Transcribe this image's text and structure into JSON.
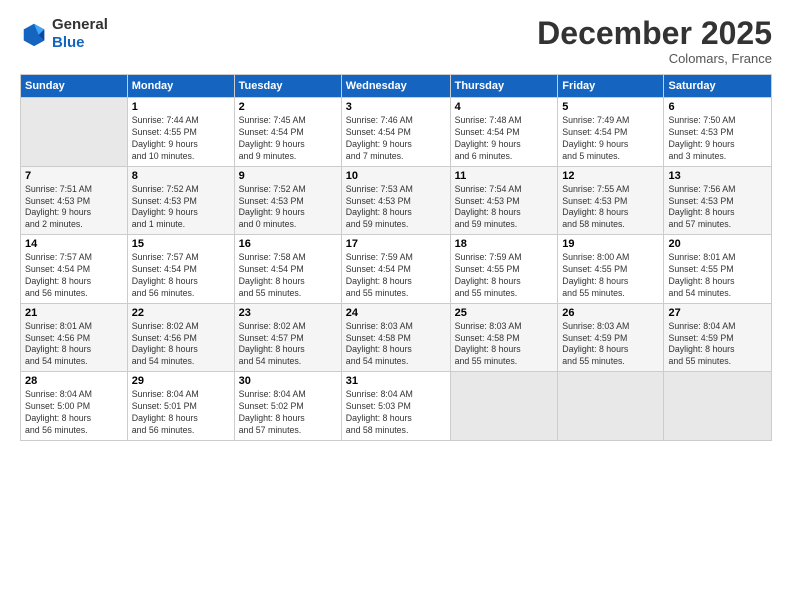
{
  "header": {
    "logo_line1": "General",
    "logo_line2": "Blue",
    "title": "December 2025",
    "location": "Colomars, France"
  },
  "days_of_week": [
    "Sunday",
    "Monday",
    "Tuesday",
    "Wednesday",
    "Thursday",
    "Friday",
    "Saturday"
  ],
  "weeks": [
    [
      {
        "day": "",
        "info": ""
      },
      {
        "day": "1",
        "info": "Sunrise: 7:44 AM\nSunset: 4:55 PM\nDaylight: 9 hours\nand 10 minutes."
      },
      {
        "day": "2",
        "info": "Sunrise: 7:45 AM\nSunset: 4:54 PM\nDaylight: 9 hours\nand 9 minutes."
      },
      {
        "day": "3",
        "info": "Sunrise: 7:46 AM\nSunset: 4:54 PM\nDaylight: 9 hours\nand 7 minutes."
      },
      {
        "day": "4",
        "info": "Sunrise: 7:48 AM\nSunset: 4:54 PM\nDaylight: 9 hours\nand 6 minutes."
      },
      {
        "day": "5",
        "info": "Sunrise: 7:49 AM\nSunset: 4:54 PM\nDaylight: 9 hours\nand 5 minutes."
      },
      {
        "day": "6",
        "info": "Sunrise: 7:50 AM\nSunset: 4:53 PM\nDaylight: 9 hours\nand 3 minutes."
      }
    ],
    [
      {
        "day": "7",
        "info": "Sunrise: 7:51 AM\nSunset: 4:53 PM\nDaylight: 9 hours\nand 2 minutes."
      },
      {
        "day": "8",
        "info": "Sunrise: 7:52 AM\nSunset: 4:53 PM\nDaylight: 9 hours\nand 1 minute."
      },
      {
        "day": "9",
        "info": "Sunrise: 7:52 AM\nSunset: 4:53 PM\nDaylight: 9 hours\nand 0 minutes."
      },
      {
        "day": "10",
        "info": "Sunrise: 7:53 AM\nSunset: 4:53 PM\nDaylight: 8 hours\nand 59 minutes."
      },
      {
        "day": "11",
        "info": "Sunrise: 7:54 AM\nSunset: 4:53 PM\nDaylight: 8 hours\nand 59 minutes."
      },
      {
        "day": "12",
        "info": "Sunrise: 7:55 AM\nSunset: 4:53 PM\nDaylight: 8 hours\nand 58 minutes."
      },
      {
        "day": "13",
        "info": "Sunrise: 7:56 AM\nSunset: 4:53 PM\nDaylight: 8 hours\nand 57 minutes."
      }
    ],
    [
      {
        "day": "14",
        "info": "Sunrise: 7:57 AM\nSunset: 4:54 PM\nDaylight: 8 hours\nand 56 minutes."
      },
      {
        "day": "15",
        "info": "Sunrise: 7:57 AM\nSunset: 4:54 PM\nDaylight: 8 hours\nand 56 minutes."
      },
      {
        "day": "16",
        "info": "Sunrise: 7:58 AM\nSunset: 4:54 PM\nDaylight: 8 hours\nand 55 minutes."
      },
      {
        "day": "17",
        "info": "Sunrise: 7:59 AM\nSunset: 4:54 PM\nDaylight: 8 hours\nand 55 minutes."
      },
      {
        "day": "18",
        "info": "Sunrise: 7:59 AM\nSunset: 4:55 PM\nDaylight: 8 hours\nand 55 minutes."
      },
      {
        "day": "19",
        "info": "Sunrise: 8:00 AM\nSunset: 4:55 PM\nDaylight: 8 hours\nand 55 minutes."
      },
      {
        "day": "20",
        "info": "Sunrise: 8:01 AM\nSunset: 4:55 PM\nDaylight: 8 hours\nand 54 minutes."
      }
    ],
    [
      {
        "day": "21",
        "info": "Sunrise: 8:01 AM\nSunset: 4:56 PM\nDaylight: 8 hours\nand 54 minutes."
      },
      {
        "day": "22",
        "info": "Sunrise: 8:02 AM\nSunset: 4:56 PM\nDaylight: 8 hours\nand 54 minutes."
      },
      {
        "day": "23",
        "info": "Sunrise: 8:02 AM\nSunset: 4:57 PM\nDaylight: 8 hours\nand 54 minutes."
      },
      {
        "day": "24",
        "info": "Sunrise: 8:03 AM\nSunset: 4:58 PM\nDaylight: 8 hours\nand 54 minutes."
      },
      {
        "day": "25",
        "info": "Sunrise: 8:03 AM\nSunset: 4:58 PM\nDaylight: 8 hours\nand 55 minutes."
      },
      {
        "day": "26",
        "info": "Sunrise: 8:03 AM\nSunset: 4:59 PM\nDaylight: 8 hours\nand 55 minutes."
      },
      {
        "day": "27",
        "info": "Sunrise: 8:04 AM\nSunset: 4:59 PM\nDaylight: 8 hours\nand 55 minutes."
      }
    ],
    [
      {
        "day": "28",
        "info": "Sunrise: 8:04 AM\nSunset: 5:00 PM\nDaylight: 8 hours\nand 56 minutes."
      },
      {
        "day": "29",
        "info": "Sunrise: 8:04 AM\nSunset: 5:01 PM\nDaylight: 8 hours\nand 56 minutes."
      },
      {
        "day": "30",
        "info": "Sunrise: 8:04 AM\nSunset: 5:02 PM\nDaylight: 8 hours\nand 57 minutes."
      },
      {
        "day": "31",
        "info": "Sunrise: 8:04 AM\nSunset: 5:03 PM\nDaylight: 8 hours\nand 58 minutes."
      },
      {
        "day": "",
        "info": ""
      },
      {
        "day": "",
        "info": ""
      },
      {
        "day": "",
        "info": ""
      }
    ]
  ]
}
